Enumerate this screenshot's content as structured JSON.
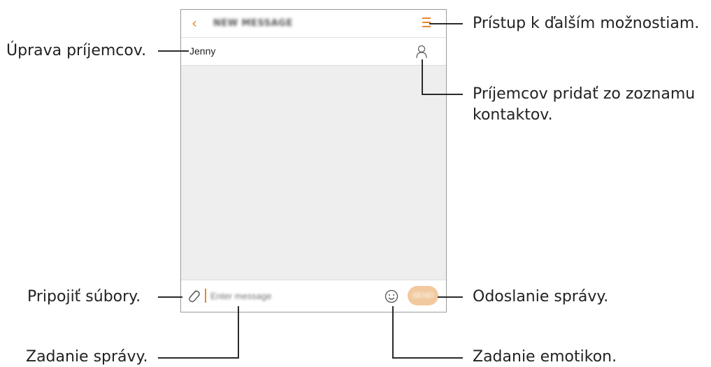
{
  "app": {
    "title": "NEW MESSAGE",
    "back_icon": "chevron-left-icon",
    "menu_icon": "menu-icon",
    "accent_color": "#e8872b"
  },
  "recipient": {
    "name": "Jenny",
    "contact_icon": "person-icon"
  },
  "compose": {
    "attach_icon": "paperclip-icon",
    "placeholder": "Enter message",
    "emoji_icon": "smiley-icon",
    "send_label": "SEND",
    "send_color": "#f2c99e"
  },
  "callouts": {
    "more_options": "Prístup k ďalším možnostiam.",
    "edit_recipients": "Úprava príjemcov.",
    "add_from_contacts_line1": "Príjemcov pridať zo zoznamu",
    "add_from_contacts_line2": "kontaktov.",
    "attach_files": "Pripojiť súbory.",
    "send_message": "Odoslanie správy.",
    "enter_message": "Zadanie správy.",
    "enter_emoticon": "Zadanie emotikon."
  }
}
